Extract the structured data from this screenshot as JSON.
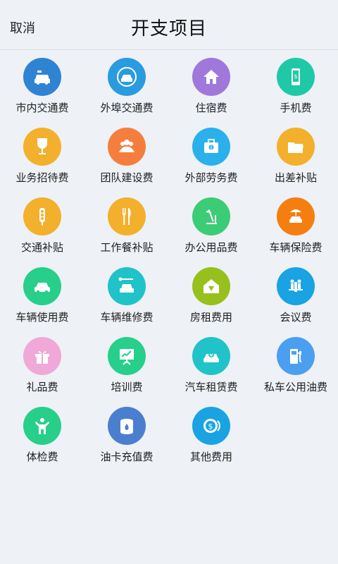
{
  "header": {
    "cancel_label": "取消",
    "title": "开支项目"
  },
  "items": [
    {
      "label": "市内交通费",
      "icon": "taxi-icon",
      "color": "#2f83d3"
    },
    {
      "label": "外埠交通费",
      "icon": "car-road-icon",
      "color": "#2b9be0"
    },
    {
      "label": "住宿费",
      "icon": "house-icon",
      "color": "#a078dc"
    },
    {
      "label": "手机费",
      "icon": "phone-icon",
      "color": "#1fc9a7"
    },
    {
      "label": "业务招待费",
      "icon": "wine-glass-icon",
      "color": "#f3b02c"
    },
    {
      "label": "团队建设费",
      "icon": "team-icon",
      "color": "#f57e3e"
    },
    {
      "label": "外部劳务费",
      "icon": "briefcase-icon",
      "color": "#2ab0ea"
    },
    {
      "label": "出差补贴",
      "icon": "folder-icon",
      "color": "#f3b02c"
    },
    {
      "label": "交通补贴",
      "icon": "traffic-light-icon",
      "color": "#f3b02c"
    },
    {
      "label": "工作餐补贴",
      "icon": "fork-knife-icon",
      "color": "#f3b02c"
    },
    {
      "label": "办公用品费",
      "icon": "desk-lamp-icon",
      "color": "#3dcc76"
    },
    {
      "label": "车辆保险费",
      "icon": "car-umbrella-icon",
      "color": "#f57e10"
    },
    {
      "label": "车辆使用费",
      "icon": "car-icon",
      "color": "#27cf8a"
    },
    {
      "label": "车辆维修费",
      "icon": "car-wrench-icon",
      "color": "#1fc3c8"
    },
    {
      "label": "房租费用",
      "icon": "house-money-icon",
      "color": "#97c01c"
    },
    {
      "label": "会议费",
      "icon": "meeting-icon",
      "color": "#1aa3e2"
    },
    {
      "label": "礼品费",
      "icon": "gift-icon",
      "color": "#f0a8d8"
    },
    {
      "label": "培训费",
      "icon": "presentation-icon",
      "color": "#27cf8a"
    },
    {
      "label": "汽车租赁费",
      "icon": "car-rental-icon",
      "color": "#1fc3c8"
    },
    {
      "label": "私车公用油费",
      "icon": "gas-pump-icon",
      "color": "#4b9ff0"
    },
    {
      "label": "体检费",
      "icon": "person-icon",
      "color": "#27cf8a"
    },
    {
      "label": "油卡充值费",
      "icon": "oil-barrel-icon",
      "color": "#4a7fd0"
    },
    {
      "label": "其他费用",
      "icon": "coins-icon",
      "color": "#1aa3e2"
    }
  ]
}
